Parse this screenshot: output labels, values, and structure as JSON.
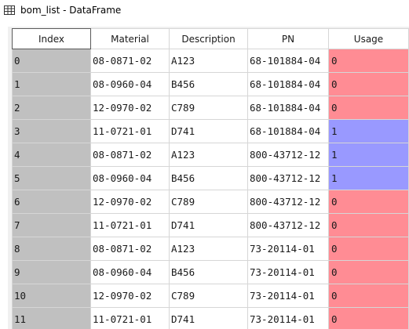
{
  "window": {
    "title": "bom_list - DataFrame",
    "icon": "table-icon"
  },
  "table": {
    "columns": [
      "Index",
      "Material",
      "Description",
      "PN",
      "Usage"
    ],
    "rows": [
      {
        "index": "0",
        "material": "08-0871-02",
        "description": "A123",
        "pn": "68-101884-04",
        "usage": "0"
      },
      {
        "index": "1",
        "material": "08-0960-04",
        "description": "B456",
        "pn": "68-101884-04",
        "usage": "0"
      },
      {
        "index": "2",
        "material": "12-0970-02",
        "description": "C789",
        "pn": "68-101884-04",
        "usage": "0"
      },
      {
        "index": "3",
        "material": "11-0721-01",
        "description": "D741",
        "pn": "68-101884-04",
        "usage": "1"
      },
      {
        "index": "4",
        "material": "08-0871-02",
        "description": "A123",
        "pn": "800-43712-12",
        "usage": "1"
      },
      {
        "index": "5",
        "material": "08-0960-04",
        "description": "B456",
        "pn": "800-43712-12",
        "usage": "1"
      },
      {
        "index": "6",
        "material": "12-0970-02",
        "description": "C789",
        "pn": "800-43712-12",
        "usage": "0"
      },
      {
        "index": "7",
        "material": "11-0721-01",
        "description": "D741",
        "pn": "800-43712-12",
        "usage": "0"
      },
      {
        "index": "8",
        "material": "08-0871-02",
        "description": "A123",
        "pn": "73-20114-01",
        "usage": "0"
      },
      {
        "index": "9",
        "material": "08-0960-04",
        "description": "B456",
        "pn": "73-20114-01",
        "usage": "0"
      },
      {
        "index": "10",
        "material": "12-0970-02",
        "description": "C789",
        "pn": "73-20114-01",
        "usage": "0"
      },
      {
        "index": "11",
        "material": "11-0721-01",
        "description": "D741",
        "pn": "73-20114-01",
        "usage": "0"
      }
    ]
  },
  "colors": {
    "usage_zero": "#ff8c94",
    "usage_one": "#9999ff",
    "index_cell": "#c0c0c0"
  }
}
